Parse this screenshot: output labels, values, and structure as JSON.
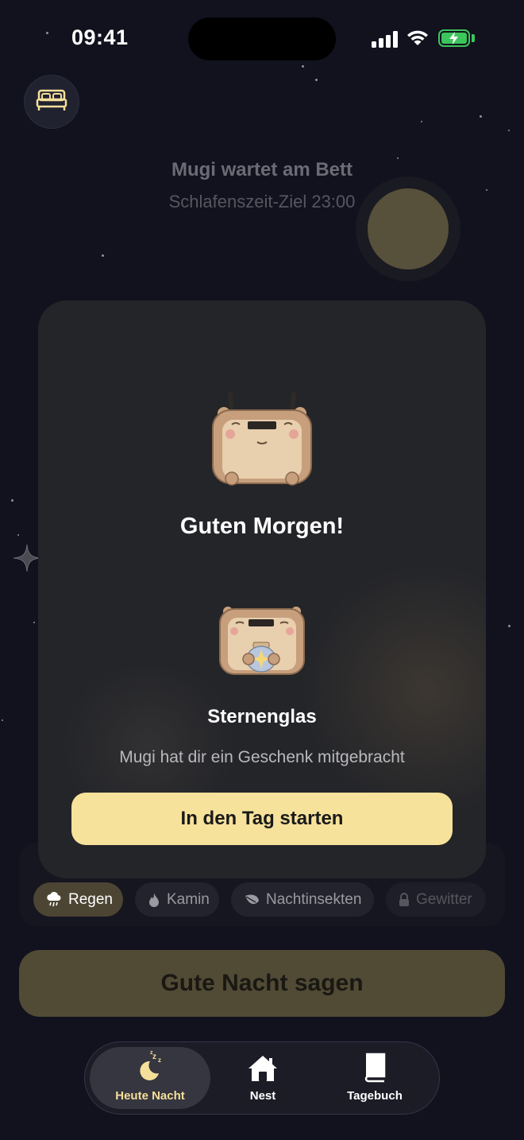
{
  "status_bar": {
    "time": "09:41"
  },
  "header": {
    "bed_button_icon": "bed-icon",
    "title": "Mugi wartet am Bett",
    "subtitle": "Schlafenszeit-Ziel 23:00"
  },
  "modal": {
    "title": "Guten Morgen!",
    "gift_name": "Sternenglas",
    "gift_description": "Mugi hat dir ein Geschenk mitgebracht",
    "start_button": "In den Tag starten"
  },
  "sound_chips": [
    {
      "label": "Regen",
      "icon": "rain-cloud-icon",
      "selected": true,
      "locked": false
    },
    {
      "label": "Kamin",
      "icon": "flame-icon",
      "selected": false,
      "locked": false
    },
    {
      "label": "Nachtinsekten",
      "icon": "leaf-icon",
      "selected": false,
      "locked": false
    },
    {
      "label": "Gewitter",
      "icon": "lock-icon",
      "selected": false,
      "locked": true
    }
  ],
  "goodnight_button": "Gute Nacht sagen",
  "tab_bar": {
    "tabs": [
      {
        "label": "Heute Nacht",
        "icon": "moon-sleep-icon",
        "active": true
      },
      {
        "label": "Nest",
        "icon": "home-icon",
        "active": false
      },
      {
        "label": "Tagebuch",
        "icon": "book-icon",
        "active": false
      }
    ]
  },
  "colors": {
    "background": "#11121e",
    "modal": "#242529",
    "accent": "#f7e29b",
    "goodnight_button": "#514a35",
    "battery": "#3cc55b"
  }
}
